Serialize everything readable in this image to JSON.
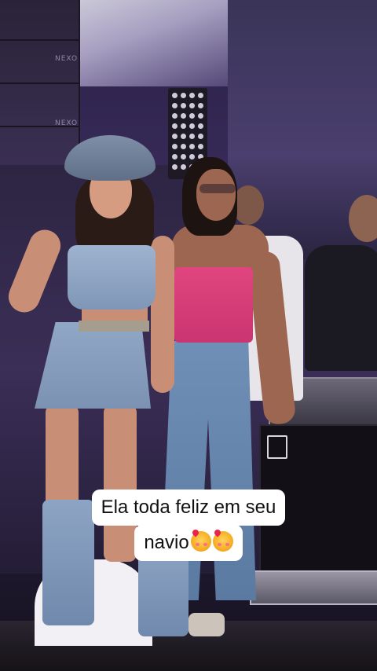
{
  "caption": {
    "line1": "Ela toda feliz em seu",
    "line2": "navio",
    "emojis": [
      "smiling-face-with-hearts",
      "smiling-face-with-hearts"
    ]
  },
  "scene": {
    "speaker_brand": "NEXO",
    "colors": {
      "stage_purple": "#3b2e57",
      "pink_top": "#e0457f",
      "denim": "#6f8fb6",
      "caption_bg": "#ffffff",
      "caption_text": "#111111"
    }
  }
}
